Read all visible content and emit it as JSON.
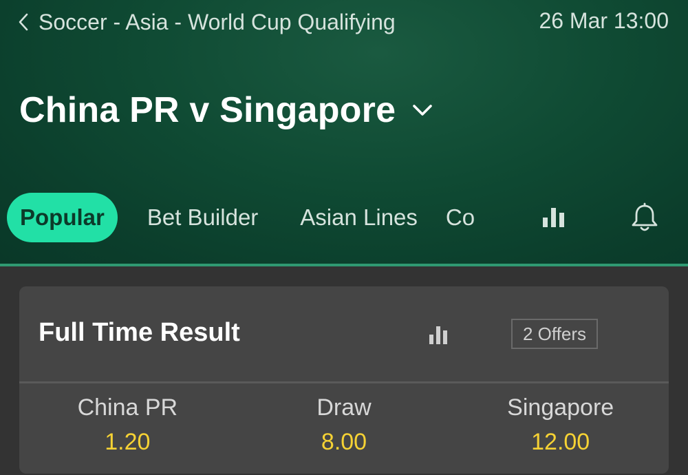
{
  "header": {
    "breadcrumb": "Soccer - Asia - World Cup Qualifying",
    "datetime": "26 Mar 13:00",
    "match_title": "China PR v Singapore"
  },
  "tabs": [
    {
      "label": "Popular",
      "active": true
    },
    {
      "label": "Bet Builder",
      "active": false
    },
    {
      "label": "Asian Lines",
      "active": false
    },
    {
      "label": "Corners",
      "active": false
    }
  ],
  "icons": {
    "back": "chevron-left-icon",
    "match_dropdown": "chevron-down-icon",
    "stats": "bar-chart-icon",
    "notifications": "bell-icon"
  },
  "market": {
    "title": "Full Time Result",
    "offers": "2 Offers",
    "outcomes": [
      {
        "name": "China PR",
        "price": "1.20"
      },
      {
        "name": "Draw",
        "price": "8.00"
      },
      {
        "name": "Singapore",
        "price": "12.00"
      }
    ]
  },
  "colors": {
    "header_bg": "#0f4a33",
    "active_tab": "#22e0a6",
    "accent_line": "#2f9a72",
    "price": "#f6d234",
    "page_bg": "#333333",
    "card_bg": "#454545"
  }
}
